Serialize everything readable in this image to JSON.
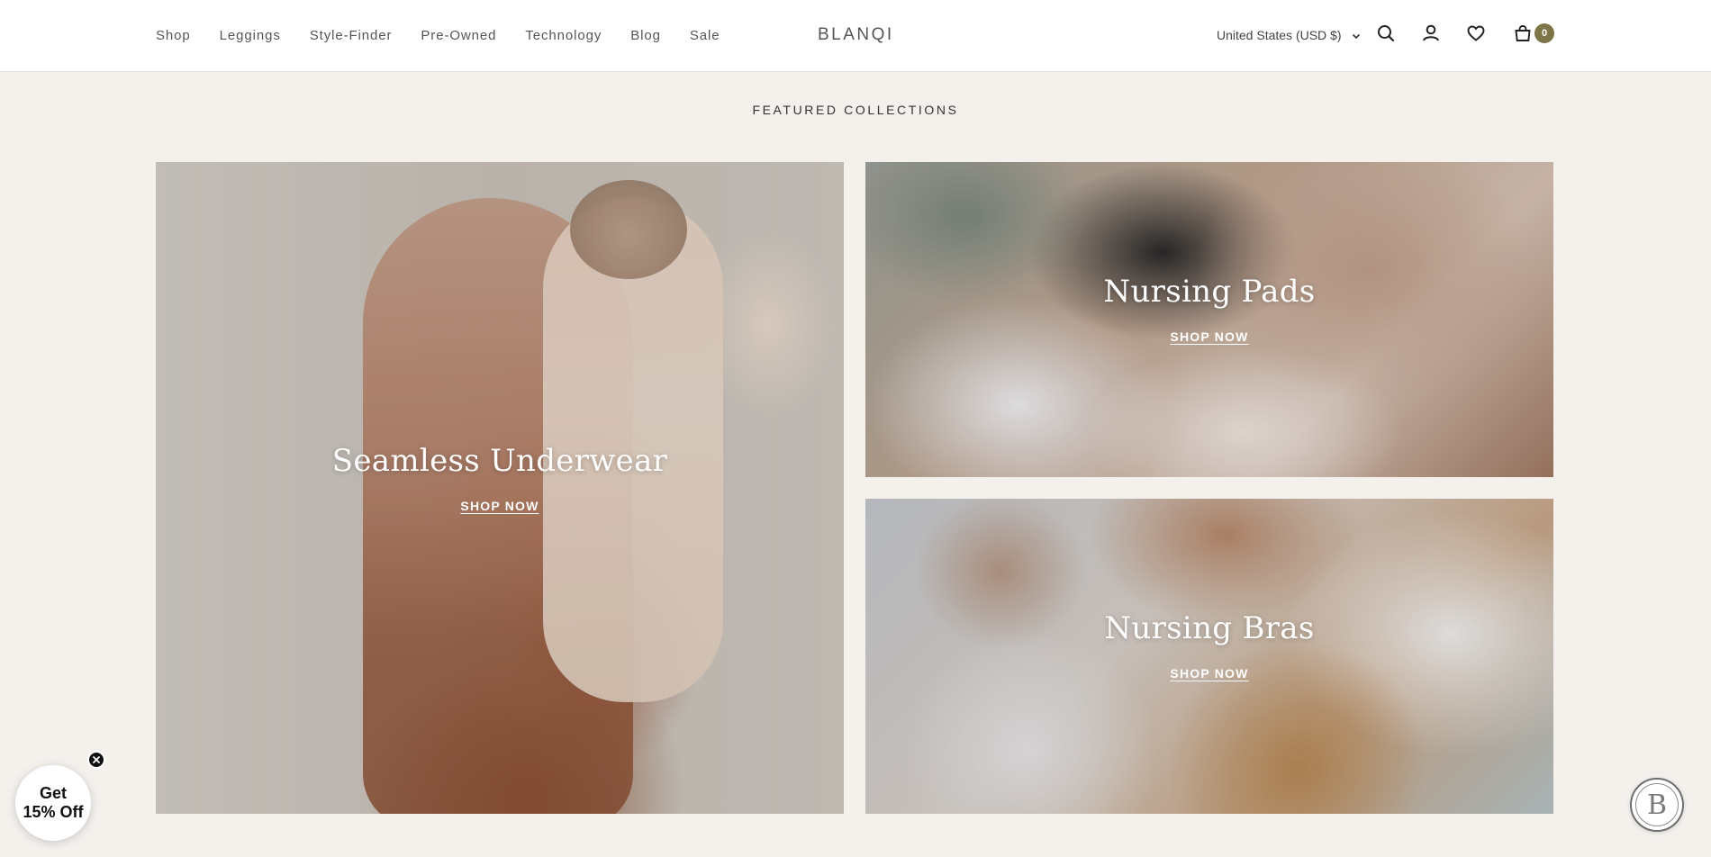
{
  "header": {
    "nav": [
      "Shop",
      "Leggings",
      "Style-Finder",
      "Pre-Owned",
      "Technology",
      "Blog",
      "Sale"
    ],
    "logo": "BLANQI",
    "currency": "United States (USD $)",
    "cart_count": "0",
    "icons": [
      "search-icon",
      "account-icon",
      "wishlist-icon",
      "cart-icon"
    ],
    "accent_color": "#7d7548"
  },
  "section": {
    "title": "FEATURED COLLECTIONS"
  },
  "collections": [
    {
      "title": "Seamless Underwear",
      "cta": "SHOP NOW"
    },
    {
      "title": "Nursing Pads",
      "cta": "SHOP NOW"
    },
    {
      "title": "Nursing Bras",
      "cta": "SHOP NOW"
    }
  ],
  "promo": {
    "line1": "Get",
    "line2": "15% Off"
  },
  "chat": {
    "label": "B"
  }
}
